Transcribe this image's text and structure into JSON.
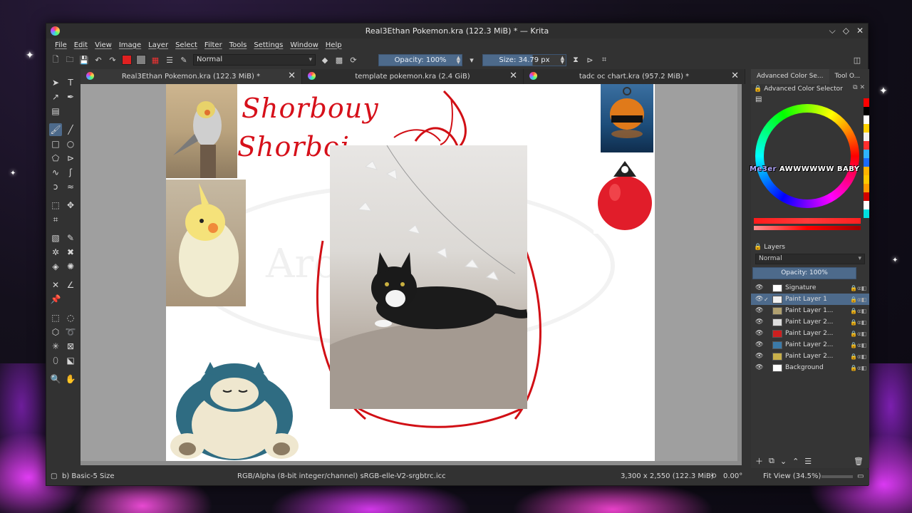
{
  "window": {
    "title": "Real3Ethan Pokemon.kra (122.3 MiB) * — Krita",
    "controls": [
      "⌵",
      "◇",
      "✕"
    ]
  },
  "menu": [
    "File",
    "Edit",
    "View",
    "Image",
    "Layer",
    "Select",
    "Filter",
    "Tools",
    "Settings",
    "Window",
    "Help"
  ],
  "toolbar": {
    "blend_mode": "Normal",
    "opacity_label": "Opacity: 100%",
    "size_label": "Size: 34.79 px",
    "fg_color": "#e02020",
    "bg_color": "#808080"
  },
  "tabs": [
    {
      "label": "Real3Ethan Pokemon.kra (122.3 MiB) *",
      "active": true
    },
    {
      "label": "template pokemon.kra (2.4 GiB)",
      "active": false
    },
    {
      "label": "tadc oc chart.kra (957.2 MiB) *",
      "active": false
    }
  ],
  "canvas": {
    "handwriting_1": "Shorbouy",
    "handwriting_2": "Shorboi",
    "watermark": "Aro",
    "images": [
      "cockatiel-gray",
      "cockatiel-yellow",
      "black-white-cat",
      "orange-buoy",
      "red-buoy",
      "snorlax"
    ]
  },
  "dock": {
    "tabs": [
      "Advanced Color Se...",
      "Tool O..."
    ],
    "color_selector_title": "Advanced Color Selector",
    "hud_text_hl": "Me3er",
    "hud_text_rest": "AWWWWWW BABY",
    "layers_title": "Layers",
    "layers_mode": "Normal",
    "layers_opacity": "Opacity: 100%",
    "layers": [
      {
        "name": "Signature",
        "selected": false,
        "thumb": "#ffffff"
      },
      {
        "name": "Paint Layer 1",
        "selected": true,
        "thumb": "#f0f0f0"
      },
      {
        "name": "Paint Layer 1...",
        "selected": false,
        "thumb": "#b0a070"
      },
      {
        "name": "Paint Layer 2...",
        "selected": false,
        "thumb": "#ddd"
      },
      {
        "name": "Paint Layer 2...",
        "selected": false,
        "thumb": "#cc1f1f"
      },
      {
        "name": "Paint Layer 2...",
        "selected": false,
        "thumb": "#3b7aa8"
      },
      {
        "name": "Paint Layer 2...",
        "selected": false,
        "thumb": "#c8b04a"
      },
      {
        "name": "Background",
        "selected": false,
        "thumb": "#ffffff"
      }
    ]
  },
  "status": {
    "brush": "b) Basic-5 Size",
    "color_space": "RGB/Alpha (8-bit integer/channel)  sRGB-elle-V2-srgbtrc.icc",
    "dimensions": "3,300 x 2,550 (122.3 MiB)",
    "rotation": "0.00°",
    "zoom": "Fit View (34.5%)"
  }
}
